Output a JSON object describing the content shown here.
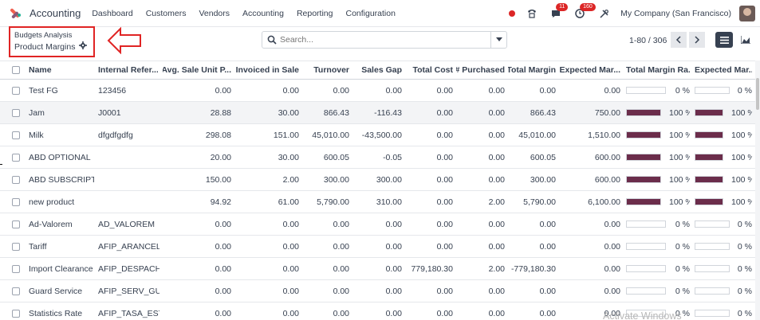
{
  "navbar": {
    "app_name": "Accounting",
    "menu": [
      "Dashboard",
      "Customers",
      "Vendors",
      "Accounting",
      "Reporting",
      "Configuration"
    ],
    "messages_badge": "11",
    "activity_badge": "160",
    "company": "My Company (San Francisco)",
    "accent": "#dc2626"
  },
  "breadcrumb": {
    "parent": "Budgets Analysis",
    "current": "Product Margins"
  },
  "search": {
    "placeholder": "Search..."
  },
  "pager": {
    "value": "1-80 / 306"
  },
  "table": {
    "columns": [
      "Name",
      "Internal Refer...",
      "Avg. Sale Unit P...",
      "# Invoiced in Sale",
      "Turnover",
      "Sales Gap",
      "Total Cost",
      "# Purchased",
      "Total Margin",
      "Expected Mar...",
      "Total Margin Ra...",
      "Expected Mar..."
    ],
    "bar_color": "#6b2d4b",
    "rows": [
      {
        "name": "Test FG",
        "ref": "123456",
        "avg": "0.00",
        "inv": "0.00",
        "turn": "0.00",
        "gap": "0.00",
        "cost": "0.00",
        "purch": "0.00",
        "margin": "0.00",
        "exp": "0.00",
        "rate": 0,
        "rate_label": "0 %",
        "exp_rate": 0,
        "exp_rate_label": "0 %"
      },
      {
        "name": "Jam",
        "ref": "J0001",
        "avg": "28.88",
        "inv": "30.00",
        "turn": "866.43",
        "gap": "-116.43",
        "cost": "0.00",
        "purch": "0.00",
        "margin": "866.43",
        "exp": "750.00",
        "rate": 100,
        "rate_label": "100 %",
        "exp_rate": 100,
        "exp_rate_label": "100 %"
      },
      {
        "name": "Milk",
        "ref": "dfgdfgdfg",
        "avg": "298.08",
        "inv": "151.00",
        "turn": "45,010.00",
        "gap": "-43,500.00",
        "cost": "0.00",
        "purch": "0.00",
        "margin": "45,010.00",
        "exp": "1,510.00",
        "rate": 100,
        "rate_label": "100 %",
        "exp_rate": 100,
        "exp_rate_label": "100 %"
      },
      {
        "name": "ABD OPTIONAL",
        "ref": "",
        "avg": "20.00",
        "inv": "30.00",
        "turn": "600.05",
        "gap": "-0.05",
        "cost": "0.00",
        "purch": "0.00",
        "margin": "600.05",
        "exp": "600.00",
        "rate": 100,
        "rate_label": "100 %",
        "exp_rate": 100,
        "exp_rate_label": "100 %"
      },
      {
        "name": "ABD SUBSCRIPTI...",
        "ref": "",
        "avg": "150.00",
        "inv": "2.00",
        "turn": "300.00",
        "gap": "300.00",
        "cost": "0.00",
        "purch": "0.00",
        "margin": "300.00",
        "exp": "600.00",
        "rate": 100,
        "rate_label": "100 %",
        "exp_rate": 100,
        "exp_rate_label": "100 %"
      },
      {
        "name": "new product",
        "ref": "",
        "avg": "94.92",
        "inv": "61.00",
        "turn": "5,790.00",
        "gap": "310.00",
        "cost": "0.00",
        "purch": "2.00",
        "margin": "5,790.00",
        "exp": "6,100.00",
        "rate": 100,
        "rate_label": "100 %",
        "exp_rate": 100,
        "exp_rate_label": "100 %"
      },
      {
        "name": "Ad-Valorem",
        "ref": "AD_VALOREM",
        "avg": "0.00",
        "inv": "0.00",
        "turn": "0.00",
        "gap": "0.00",
        "cost": "0.00",
        "purch": "0.00",
        "margin": "0.00",
        "exp": "0.00",
        "rate": 0,
        "rate_label": "0 %",
        "exp_rate": 0,
        "exp_rate_label": "0 %"
      },
      {
        "name": "Tariff",
        "ref": "AFIP_ARANCEL",
        "avg": "0.00",
        "inv": "0.00",
        "turn": "0.00",
        "gap": "0.00",
        "cost": "0.00",
        "purch": "0.00",
        "margin": "0.00",
        "exp": "0.00",
        "rate": 0,
        "rate_label": "0 %",
        "exp_rate": 0,
        "exp_rate_label": "0 %"
      },
      {
        "name": "Import Clearance",
        "ref": "AFIP_DESPACHO",
        "avg": "0.00",
        "inv": "0.00",
        "turn": "0.00",
        "gap": "0.00",
        "cost": "779,180.30",
        "purch": "2.00",
        "margin": "-779,180.30",
        "exp": "0.00",
        "rate": 0,
        "rate_label": "0 %",
        "exp_rate": 0,
        "exp_rate_label": "0 %"
      },
      {
        "name": "Guard Service",
        "ref": "AFIP_SERV_GUA...",
        "avg": "0.00",
        "inv": "0.00",
        "turn": "0.00",
        "gap": "0.00",
        "cost": "0.00",
        "purch": "0.00",
        "margin": "0.00",
        "exp": "0.00",
        "rate": 0,
        "rate_label": "0 %",
        "exp_rate": 0,
        "exp_rate_label": "0 %"
      },
      {
        "name": "Statistics Rate",
        "ref": "AFIP_TASA_EST",
        "avg": "0.00",
        "inv": "0.00",
        "turn": "0.00",
        "gap": "0.00",
        "cost": "0.00",
        "purch": "0.00",
        "margin": "0.00",
        "exp": "0.00",
        "rate": 0,
        "rate_label": "0 %",
        "exp_rate": 0,
        "exp_rate_label": "0 %"
      }
    ]
  },
  "watermark": "Activate Windows"
}
